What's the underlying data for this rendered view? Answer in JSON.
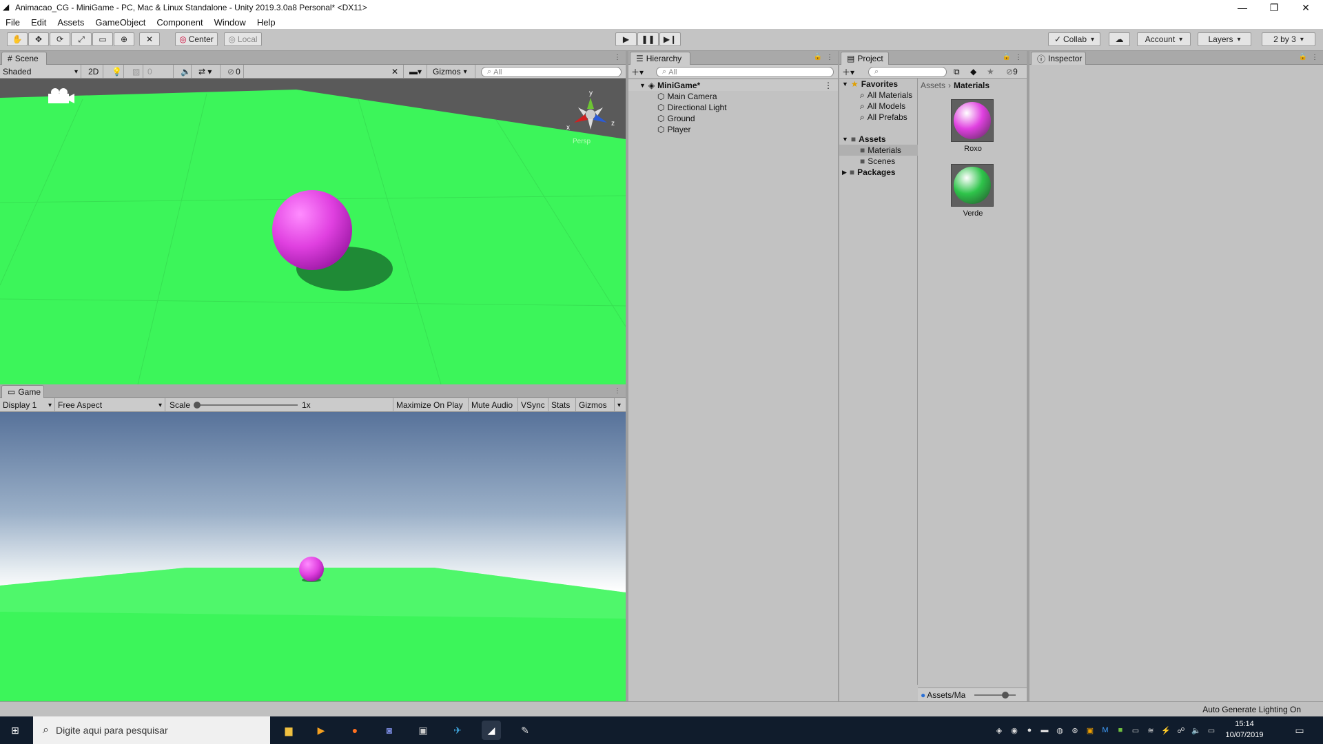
{
  "window": {
    "title": "Animacao_CG - MiniGame - PC, Mac & Linux Standalone - Unity 2019.3.0a8 Personal* <DX11>",
    "controls": [
      "—",
      "❐",
      "✕"
    ]
  },
  "menu": [
    "File",
    "Edit",
    "Assets",
    "GameObject",
    "Component",
    "Window",
    "Help"
  ],
  "toolbar": {
    "pivot": "Center",
    "space": "Local",
    "collab": "Collab",
    "account": "Account",
    "layers": "Layers",
    "layout": "2 by 3"
  },
  "scene": {
    "tab": "Scene",
    "shading": "Shaded",
    "mode2d": "2D",
    "fx_count": "0",
    "hidden_count": "0",
    "gizmos": "Gizmos",
    "search_placeholder": "All",
    "persp": "Persp",
    "axis_y": "y",
    "axis_x": "x",
    "axis_z": "z"
  },
  "game": {
    "tab": "Game",
    "display": "Display 1",
    "aspect": "Free Aspect",
    "scale_label": "Scale",
    "scale_value": 0,
    "scale_text": "1x",
    "buttons": [
      "Maximize On Play",
      "Mute Audio",
      "VSync",
      "Stats",
      "Gizmos"
    ]
  },
  "hierarchy": {
    "tab": "Hierarchy",
    "search_placeholder": "All",
    "scene_name": "MiniGame*",
    "objects": [
      "Main Camera",
      "Directional Light",
      "Ground",
      "Player"
    ]
  },
  "project": {
    "tab": "Project",
    "hidden_count": "9",
    "favorites_label": "Favorites",
    "favorites": [
      "All Materials",
      "All Models",
      "All Prefabs"
    ],
    "assets_label": "Assets",
    "asset_folders": [
      "Materials",
      "Scenes"
    ],
    "packages_label": "Packages",
    "breadcrumb": [
      "Assets",
      "Materials"
    ],
    "materials": [
      {
        "name": "Roxo",
        "color": "#e040e0"
      },
      {
        "name": "Verde",
        "color": "#2ec44a"
      }
    ],
    "bottom_path": "Assets/Mat",
    "icon_size": 0.75
  },
  "inspector": {
    "tab": "Inspector"
  },
  "status": {
    "right": "Auto Generate Lighting On"
  },
  "taskbar": {
    "search_placeholder": "Digite aqui para pesquisar",
    "time": "15:14",
    "date": "10/07/2019"
  },
  "colors": {
    "ground": "#3cf55a",
    "sphere": "#e040e0",
    "sky_top": "#57729a",
    "editor_bg": "#c2c2c2"
  }
}
